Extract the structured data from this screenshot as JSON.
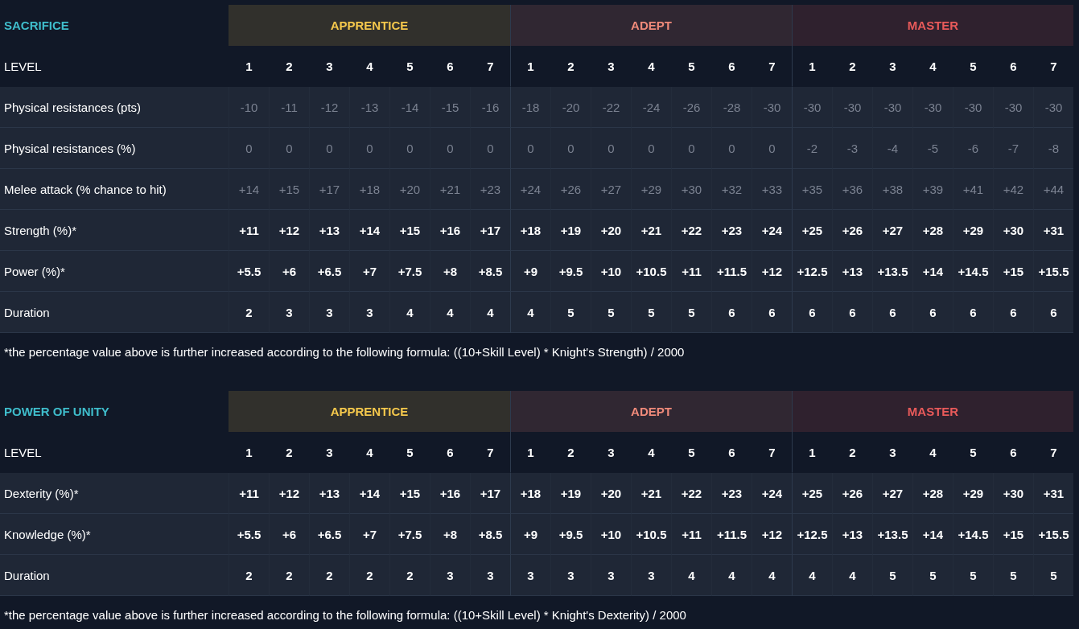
{
  "sections": [
    {
      "title": "SACRIFICE",
      "tiers": [
        {
          "label": "APPRENTICE",
          "color": "#f5c84c"
        },
        {
          "label": "ADEPT",
          "color": "#ef8a7a"
        },
        {
          "label": "MASTER",
          "color": "#e85a5a"
        }
      ],
      "level_label": "LEVEL",
      "levels": [
        "1",
        "2",
        "3",
        "4",
        "5",
        "6",
        "7",
        "1",
        "2",
        "3",
        "4",
        "5",
        "6",
        "7",
        "1",
        "2",
        "3",
        "4",
        "5",
        "6",
        "7"
      ],
      "rows": [
        {
          "label": "Physical resistances (pts)",
          "dimmed": true,
          "values": [
            "-10",
            "-11",
            "-12",
            "-13",
            "-14",
            "-15",
            "-16",
            "-18",
            "-20",
            "-22",
            "-24",
            "-26",
            "-28",
            "-30",
            "-30",
            "-30",
            "-30",
            "-30",
            "-30",
            "-30",
            "-30"
          ]
        },
        {
          "label": "Physical resistances (%)",
          "dimmed": true,
          "values": [
            "0",
            "0",
            "0",
            "0",
            "0",
            "0",
            "0",
            "0",
            "0",
            "0",
            "0",
            "0",
            "0",
            "0",
            "-2",
            "-3",
            "-4",
            "-5",
            "-6",
            "-7",
            "-8"
          ]
        },
        {
          "label": "Melee attack (% chance to hit)",
          "dimmed": true,
          "values": [
            "+14",
            "+15",
            "+17",
            "+18",
            "+20",
            "+21",
            "+23",
            "+24",
            "+26",
            "+27",
            "+29",
            "+30",
            "+32",
            "+33",
            "+35",
            "+36",
            "+38",
            "+39",
            "+41",
            "+42",
            "+44"
          ]
        },
        {
          "label": "Strength (%)*",
          "dimmed": false,
          "values": [
            "+11",
            "+12",
            "+13",
            "+14",
            "+15",
            "+16",
            "+17",
            "+18",
            "+19",
            "+20",
            "+21",
            "+22",
            "+23",
            "+24",
            "+25",
            "+26",
            "+27",
            "+28",
            "+29",
            "+30",
            "+31"
          ]
        },
        {
          "label": "Power (%)*",
          "dimmed": false,
          "values": [
            "+5.5",
            "+6",
            "+6.5",
            "+7",
            "+7.5",
            "+8",
            "+8.5",
            "+9",
            "+9.5",
            "+10",
            "+10.5",
            "+11",
            "+11.5",
            "+12",
            "+12.5",
            "+13",
            "+13.5",
            "+14",
            "+14.5",
            "+15",
            "+15.5"
          ]
        },
        {
          "label": "Duration",
          "dimmed": false,
          "values": [
            "2",
            "3",
            "3",
            "3",
            "4",
            "4",
            "4",
            "4",
            "5",
            "5",
            "5",
            "5",
            "6",
            "6",
            "6",
            "6",
            "6",
            "6",
            "6",
            "6",
            "6"
          ]
        }
      ],
      "footnote": "*the percentage value above is further increased according to the following formula: ((10+Skill Level) * Knight's Strength) / 2000"
    },
    {
      "title": "POWER OF UNITY",
      "tiers": [
        {
          "label": "APPRENTICE",
          "color": "#f5c84c"
        },
        {
          "label": "ADEPT",
          "color": "#ef8a7a"
        },
        {
          "label": "MASTER",
          "color": "#e85a5a"
        }
      ],
      "level_label": "LEVEL",
      "levels": [
        "1",
        "2",
        "3",
        "4",
        "5",
        "6",
        "7",
        "1",
        "2",
        "3",
        "4",
        "5",
        "6",
        "7",
        "1",
        "2",
        "3",
        "4",
        "5",
        "6",
        "7"
      ],
      "rows": [
        {
          "label": "Dexterity (%)*",
          "dimmed": false,
          "values": [
            "+11",
            "+12",
            "+13",
            "+14",
            "+15",
            "+16",
            "+17",
            "+18",
            "+19",
            "+20",
            "+21",
            "+22",
            "+23",
            "+24",
            "+25",
            "+26",
            "+27",
            "+28",
            "+29",
            "+30",
            "+31"
          ]
        },
        {
          "label": "Knowledge (%)*",
          "dimmed": false,
          "values": [
            "+5.5",
            "+6",
            "+6.5",
            "+7",
            "+7.5",
            "+8",
            "+8.5",
            "+9",
            "+9.5",
            "+10",
            "+10.5",
            "+11",
            "+11.5",
            "+12",
            "+12.5",
            "+13",
            "+13.5",
            "+14",
            "+14.5",
            "+15",
            "+15.5"
          ]
        },
        {
          "label": "Duration",
          "dimmed": false,
          "values": [
            "2",
            "2",
            "2",
            "2",
            "2",
            "3",
            "3",
            "3",
            "3",
            "3",
            "3",
            "4",
            "4",
            "4",
            "4",
            "4",
            "5",
            "5",
            "5",
            "5",
            "5"
          ]
        }
      ],
      "footnote": "*the percentage value above is further increased according to the following formula: ((10+Skill Level) * Knight's Dexterity) / 2000"
    }
  ]
}
